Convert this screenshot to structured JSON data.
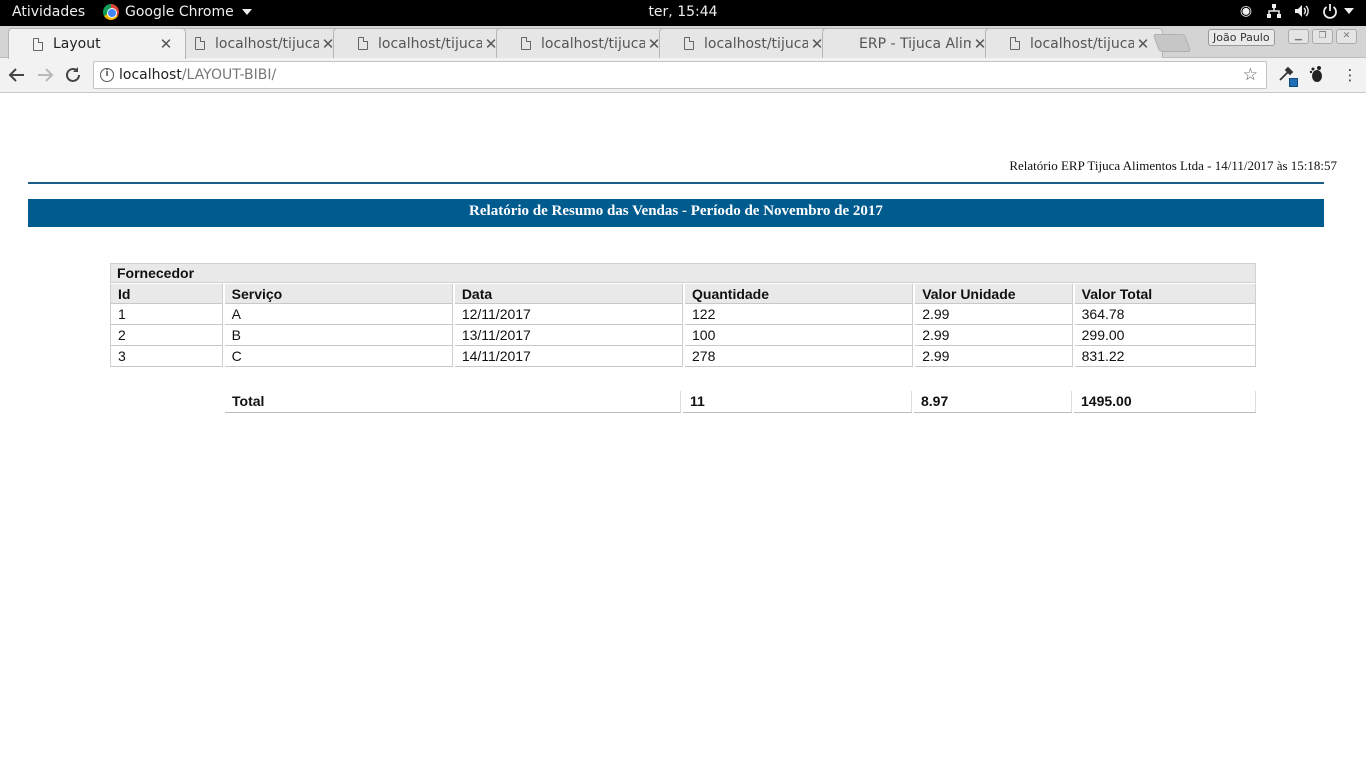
{
  "system_bar": {
    "activities": "Atividades",
    "app_name": "Google Chrome",
    "clock": "ter, 15:44"
  },
  "tabs": [
    {
      "title": "Layout",
      "active": true
    },
    {
      "title": "localhost/tijuca",
      "active": false
    },
    {
      "title": "localhost/tijuca",
      "active": false
    },
    {
      "title": "localhost/tijuca",
      "active": false
    },
    {
      "title": "localhost/tijuca",
      "active": false
    },
    {
      "title": "ERP - Tijuca Alim",
      "active": false
    },
    {
      "title": "localhost/tijuca",
      "active": false
    }
  ],
  "profile": "João Paulo",
  "omnibox": {
    "host": "localhost",
    "path": "/LAYOUT-BIBI/"
  },
  "report": {
    "meta": "Relatório ERP Tijuca Alimentos Ltda - 14/11/2017 às 15:18:57",
    "title": "Relatório de Resumo das Vendas - Período de Novembro de 2017",
    "group_label": "Fornecedor",
    "columns": [
      "Id",
      "Serviço",
      "Data",
      "Quantidade",
      "Valor Unidade",
      "Valor Total"
    ],
    "rows": [
      [
        "1",
        "A",
        "12/11/2017",
        "122",
        "2.99",
        "364.78"
      ],
      [
        "2",
        "B",
        "13/11/2017",
        "100",
        "2.99",
        "299.00"
      ],
      [
        "3",
        "C",
        "14/11/2017",
        "278",
        "2.99",
        "831.22"
      ]
    ],
    "total": {
      "label": "Total",
      "quantidade": "11",
      "valor_unidade": "8.97",
      "valor_total": "1495.00"
    }
  },
  "colors": {
    "title_bar": "#005b8f",
    "rule": "#1b5f89"
  }
}
